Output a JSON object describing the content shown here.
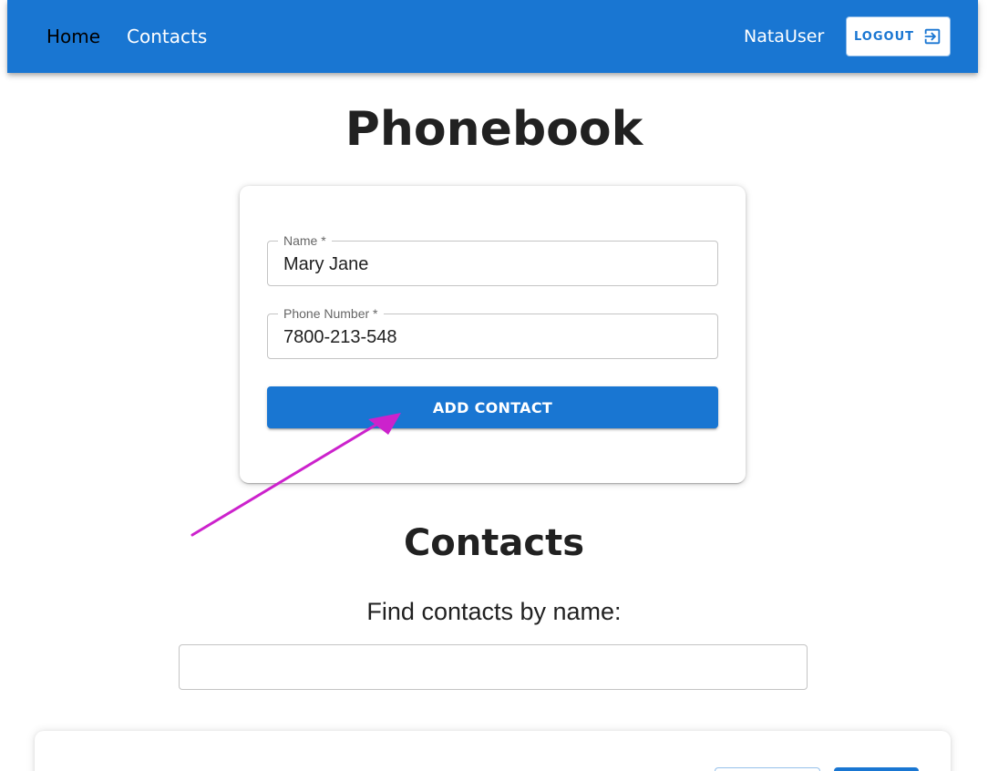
{
  "nav": {
    "home_label": "Home",
    "contacts_label": "Contacts",
    "username": "NataUser",
    "logout_label": "LOGOUT",
    "logout_icon": "logout-icon"
  },
  "page": {
    "title": "Phonebook"
  },
  "form": {
    "name_label": "Name *",
    "name_value": "Mary Jane",
    "phone_label": "Phone Number *",
    "phone_value": "7800-213-548",
    "submit_label": "ADD CONTACT"
  },
  "contacts": {
    "title": "Contacts",
    "filter_label": "Find contacts by name:",
    "filter_value": ""
  },
  "colors": {
    "primary": "#1976d2",
    "annotation_arrow": "#cc22cc"
  }
}
